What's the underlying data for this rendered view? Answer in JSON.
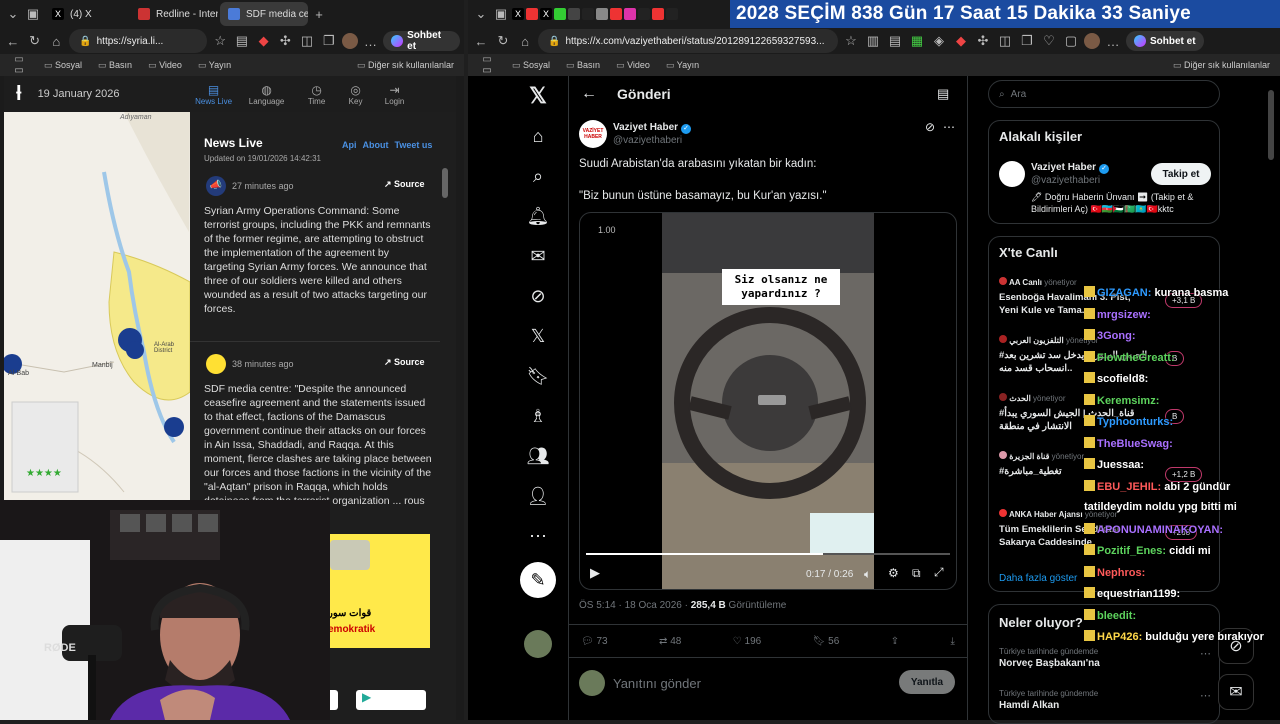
{
  "left_window": {
    "tabs": [
      {
        "title": "(4) X"
      },
      {
        "title": "Redline - Intern"
      },
      {
        "title": "SDF media cen"
      }
    ],
    "url": "https://syria.li...",
    "profile_label": "Sohbet et",
    "bookmarks": [
      "Sosyal",
      "Basın",
      "Video",
      "Yayın"
    ],
    "bookmarks_other": "Diğer sık kullanılanlar"
  },
  "right_window": {
    "tabs": [
      "X",
      "X"
    ],
    "countdown": "2028 SEÇİM 838 Gün 17 Saat 15 Dakika 33 Saniye",
    "url": "https://x.com/vaziyethaberi/status/201289122659327593...",
    "profile_label": "Sohbet et",
    "bookmarks": [
      "Sosyal",
      "Basın",
      "Video",
      "Yayın"
    ],
    "bookmarks_other": "Diğer sık kullanılanlar"
  },
  "livemap": {
    "date": "19 January 2026",
    "nav": [
      "News Live",
      "Language",
      "Time",
      "Key",
      "Login"
    ],
    "map_labels": [
      "Adıyaman",
      "Manbij",
      "Al-Bab",
      "Al-Arab District"
    ],
    "panel_title": "News Live",
    "panel_links": [
      "Api",
      "About",
      "Tweet us"
    ],
    "updated": "Updated on 19/01/2026 14:42:31",
    "items": [
      {
        "time": "27 minutes ago",
        "source": "Source",
        "text": "Syrian Army Operations Command: Some terrorist groups, including the PKK and remnants of the former regime, are attempting to obstruct the implementation of the agreement by targeting Syrian Army forces. We announce that three of our soldiers were killed and others wounded as a result of two attacks targeting our forces."
      },
      {
        "time": "38 minutes ago",
        "source": "Source",
        "text": "SDF media centre: \"Despite the announced ceasefire agreement and the statements issued to that effect, factions of the Damascus government continue their attacks on our forces in Ain Issa, Shaddadi, and Raqqa. At this moment, fierce clashes are taking place between our forces and those factions in the vicinity of the \"al-Aqtan\" prison in Raqqa, which holds detainees from the terrorist organization ... rous development.\""
      }
    ],
    "image_text": [
      "قوات سور",
      "emokratik"
    ]
  },
  "webcam": {
    "mic_label": "RØDE"
  },
  "x": {
    "header_title": "Gönderi",
    "author": {
      "name": "Vaziyet Haber",
      "handle": "@vaziyethaberi",
      "avatar_text": "VAZİYET HABER"
    },
    "post_text_1": "Suudi Arabistan'da arabasını yıkatan bir kadın:",
    "post_text_2": "\"Biz bunun üstüne basamayız, bu Kur'an yazısı.\"",
    "video": {
      "overlay_1": "Siz olsanız ne",
      "overlay_2": "yapardınız ?",
      "time": "0:17 / 0:26",
      "corner": "1.00",
      "progress": 0.65
    },
    "meta_time": "ÖS 5:14 · 18 Oca 2026 ·",
    "views": "285,4 B",
    "views_label": "Görüntüleme",
    "actions": [
      {
        "icon": "reply-icon",
        "count": "73"
      },
      {
        "icon": "repost-icon",
        "count": "48"
      },
      {
        "icon": "like-icon",
        "count": "196"
      },
      {
        "icon": "bookmark-icon",
        "count": "56"
      }
    ],
    "reply_placeholder": "Yanıtını gönder",
    "reply_button": "Yanıtla",
    "search_placeholder": "Ara",
    "related": {
      "title": "Alakalı kişiler",
      "name": "Vaziyet Haber",
      "handle": "@vaziyethaberi",
      "follow": "Takip et",
      "bio": "🖊 Doğru Haberin Ünvanı ➡ (Takip et & Bildirimleri Aç) 🇹🇷🇦🇿🇵🇸🇹🇲🇰🇿🇹🇷kktc"
    },
    "live": {
      "title": "X'te Canlı",
      "items": [
        {
          "host": "AA Canlı",
          "role": "yönetiyor",
          "title": "Esenboğa Havalimanı 3. Pist, Yeni Kule ve Tama...",
          "count": "+3,1 B"
        },
        {
          "host": "التلفزيون العربي",
          "role": "yönetiyor",
          "title": "#الجيش السوري يدخل سد تشرين بعد انسحاب قسد منه..",
          "count": "B"
        },
        {
          "host": "الحدث",
          "role": "yönetiyor",
          "title": "#قناة_الحدث | الجيش السوري يبدأ الانتشار في منطقة",
          "count": "B"
        },
        {
          "host": "قناة الجزيرة",
          "role": "yönetiyor",
          "title": "#تغطية_مباشرة",
          "count": "+1,2 B"
        },
        {
          "host": "ANKA Haber Ajansı",
          "role": "yönetiyor",
          "title": "Tüm Emeklilerin Sendikası Sakarya Caddesinde",
          "count": "+268"
        }
      ],
      "more": "Daha fazla göster"
    },
    "trends": {
      "title": "Neler oluyor?",
      "items": [
        {
          "context": "Türkiye tarihinde gündemde",
          "name": "Norveç Başbakanı'na"
        },
        {
          "context": "Türkiye tarihinde gündemde",
          "name": "Hamdi Alkan"
        }
      ]
    }
  },
  "chat": [
    {
      "user": "GIZAGAN",
      "color": "#2e9bff",
      "msg": "kurana basma"
    },
    {
      "user": "mrgsizew",
      "color": "#a970ff",
      "msg": ""
    },
    {
      "user": "3Gong",
      "color": "#a970ff",
      "msg": ""
    },
    {
      "user": "FlowtheGreatt",
      "color": "#5dd35d",
      "msg": ""
    },
    {
      "user": "scofield8",
      "color": "#ffffff",
      "msg": ""
    },
    {
      "user": "Keremsimz",
      "color": "#5dd35d",
      "msg": ""
    },
    {
      "user": "Typhoonturks",
      "color": "#2e9bff",
      "msg": ""
    },
    {
      "user": "TheBlueSwag",
      "color": "#a970ff",
      "msg": ""
    },
    {
      "user": "Juessaa",
      "color": "#ffffff",
      "msg": ""
    },
    {
      "user": "EBU_JEHIL",
      "color": "#ff5a5a",
      "msg": "abi 2 gündür"
    },
    {
      "user": "",
      "color": "#ffffff",
      "msg": "tatildeydim noldu ypg bitti mi"
    },
    {
      "user": "APONUNAMINAKOYAN",
      "color": "#a970ff",
      "msg": ""
    },
    {
      "user": "Pozitif_Enes",
      "color": "#5dd35d",
      "msg": "ciddi mi"
    },
    {
      "user": "Nephros",
      "color": "#ff5a5a",
      "msg": ""
    },
    {
      "user": "equestrian1199",
      "color": "#ffffff",
      "msg": ""
    },
    {
      "user": "bleedit",
      "color": "#5dd35d",
      "msg": ""
    },
    {
      "user": "HAP426",
      "color": "#ffd84a",
      "msg": "bulduğu yere bırakıyor"
    }
  ]
}
